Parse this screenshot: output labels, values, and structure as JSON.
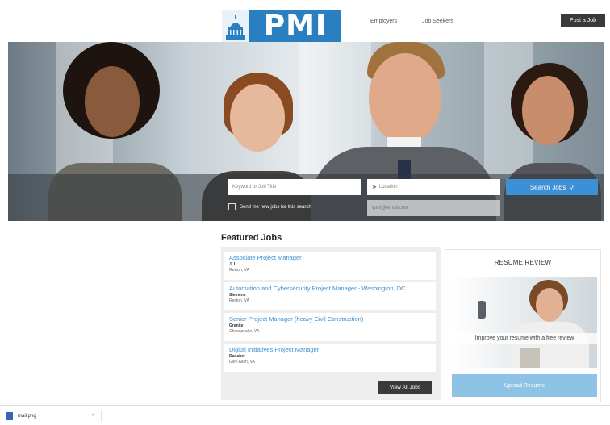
{
  "header": {
    "logo_text": "PMI",
    "nav": {
      "employers": "Employers",
      "job_seekers": "Job Seekers"
    },
    "post_job": "Post a Job"
  },
  "search": {
    "keyword_placeholder": "Keyword or Job Title",
    "location_placeholder": "Location",
    "button": "Search Jobs",
    "notify_label": "Send me new jobs for this search",
    "email_placeholder": "your@email.com"
  },
  "featured": {
    "title": "Featured Jobs",
    "jobs": [
      {
        "title": "Associate Project Manager",
        "company": "JLL",
        "location": "Reston, VA"
      },
      {
        "title": "Automation and Cybersecurity Project Manager - Washington, DC",
        "company": "Siemens",
        "location": "Reston, VA"
      },
      {
        "title": "Senior Project Manager (heavy Civil Construction)",
        "company": "Granite",
        "location": "Chesapeake, VA"
      },
      {
        "title": "Digital Initiatives Project Manager",
        "company": "Danaher",
        "location": "Glen Allen, VA"
      }
    ],
    "view_all": "View All Jobs"
  },
  "resume": {
    "title": "RESUME REVIEW",
    "caption": "Improve your resume with a free review",
    "upload": "Upload Resume"
  },
  "download_bar": {
    "file_name": "mail.png"
  },
  "colors": {
    "accent": "#3d8fd6",
    "logo_blue": "#2a7fc0",
    "dark_button": "#3a3a3a",
    "link": "#3b8fd1"
  }
}
